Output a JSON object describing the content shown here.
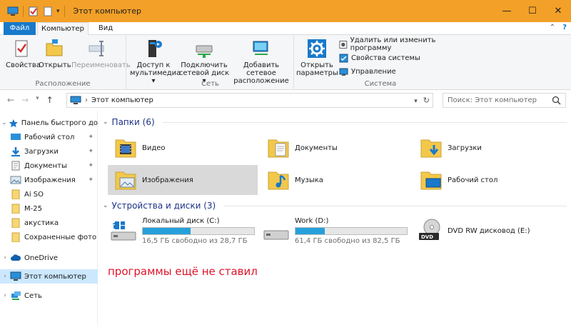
{
  "window": {
    "title": "Этот компьютер",
    "accent": "#f3a028"
  },
  "ribbon_tabs": {
    "file": "Файл",
    "computer": "Компьютер",
    "view": "Вид"
  },
  "ribbon": {
    "groups": {
      "location": "Расположение",
      "network": "Сеть",
      "system": "Система"
    },
    "properties": "Свойства",
    "open": "Открыть",
    "rename": "Переименовать",
    "media_access_1": "Доступ к",
    "media_access_2": "мультимедиа",
    "map_drive_1": "Подключить",
    "map_drive_2": "сетевой диск",
    "add_network_1": "Добавить сетевое",
    "add_network_2": "расположение",
    "open_params_1": "Открыть",
    "open_params_2": "параметры",
    "uninstall": "Удалить или изменить программу",
    "sys_props": "Свойства системы",
    "manage": "Управление"
  },
  "address": {
    "path": "Этот компьютер",
    "search_placeholder": "Поиск: Этот компьютер"
  },
  "nav": {
    "quick_access": "Панель быстрого до",
    "items": [
      {
        "label": "Рабочий стол",
        "pinned": true
      },
      {
        "label": "Загрузки",
        "pinned": true
      },
      {
        "label": "Документы",
        "pinned": true
      },
      {
        "label": "Изображения",
        "pinned": true
      },
      {
        "label": "Ai SO",
        "pinned": false
      },
      {
        "label": "M-25",
        "pinned": false
      },
      {
        "label": "акустика",
        "pinned": false
      },
      {
        "label": "Сохраненные фото",
        "pinned": false
      }
    ],
    "onedrive": "OneDrive",
    "this_pc": "Этот компьютер",
    "network": "Сеть"
  },
  "folders_section": "Папки (6)",
  "folders": [
    "Видео",
    "Документы",
    "Загрузки",
    "Изображения",
    "Музыка",
    "Рабочий стол"
  ],
  "devices_section": "Устройства и диски (3)",
  "drives": [
    {
      "name": "Локальный диск (C:)",
      "free": "16,5 ГБ свободно из 28,7 ГБ",
      "used_fraction": 0.43
    },
    {
      "name": "Work (D:)",
      "free": "61,4 ГБ свободно из 82,5 ГБ",
      "used_fraction": 0.26
    },
    {
      "name": "DVD RW дисковод (E:)"
    }
  ],
  "note": "программы ещё не ставил"
}
